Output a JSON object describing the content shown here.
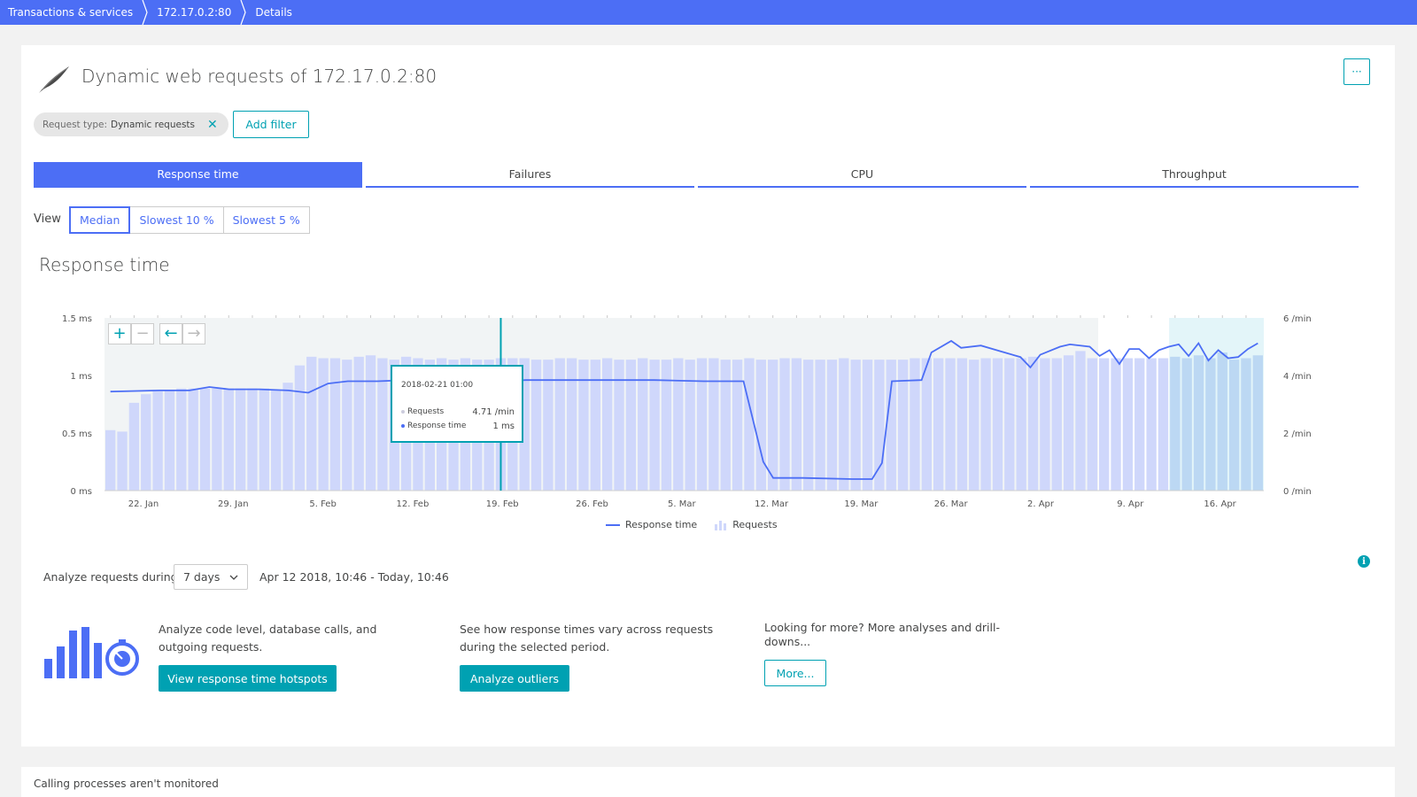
{
  "breadcrumb": [
    "Transactions & services",
    "172.17.0.2:80",
    "Details"
  ],
  "header": {
    "title": "Dynamic web requests of 172.17.0.2:80",
    "more_label": "···"
  },
  "filter": {
    "key": "Request type:",
    "value": "Dynamic requests",
    "remove": "✕",
    "add_label": "Add filter"
  },
  "tabs": [
    "Response time",
    "Failures",
    "CPU",
    "Throughput"
  ],
  "active_tab": "Response time",
  "view": {
    "label": "View",
    "options": [
      "Median",
      "Slowest 10 %",
      "Slowest 5 %"
    ],
    "selected": "Median"
  },
  "chart_title": "Response time",
  "zoom": {
    "zoom_in": "+",
    "zoom_out": "−",
    "back": "←",
    "forward": "→"
  },
  "tooltip": {
    "date": "2018-02-21 01:00",
    "requests_label": "Requests",
    "requests_value": "4.71 /min",
    "response_label": "Response time",
    "response_value": "1 ms"
  },
  "legend": {
    "response": "Response time",
    "requests": "Requests"
  },
  "colors": {
    "brand": "#4c6ef5",
    "accent": "#00a1b2",
    "bar": "#cfd7fb",
    "bar_highlight": "#bcd8f3"
  },
  "analyze": {
    "label": "Analyze requests during",
    "timeframe": "7 days",
    "range": "Apr 12 2018, 10:46 - Today, 10:46"
  },
  "actions": [
    {
      "text": "Analyze code level, database calls, and outgoing requests.",
      "button": "View response time hotspots"
    },
    {
      "text": "See how response times vary across requests during the selected period.",
      "button": "Analyze outliers"
    },
    {
      "text": "Looking for more? More analyses and drill-downs...",
      "button": "More..."
    }
  ],
  "footer_card": {
    "text": "Calling processes aren't monitored"
  },
  "chart_data": {
    "type": "bar+line",
    "x_ticks": [
      "22. Jan",
      "29. Jan",
      "5. Feb",
      "12. Feb",
      "19. Feb",
      "26. Feb",
      "5. Mar",
      "12. Mar",
      "19. Mar",
      "26. Mar",
      "2. Apr",
      "9. Apr",
      "16. Apr"
    ],
    "y_left": {
      "ticks": [
        "1.5 ms",
        "1 ms",
        "0.5 ms",
        "0 ms"
      ],
      "range": [
        0,
        1.5
      ],
      "unit": "ms"
    },
    "y_right": {
      "ticks": [
        "6 /min",
        "4 /min",
        "2 /min",
        "0 /min"
      ],
      "range": [
        0,
        6
      ],
      "unit": "/min"
    },
    "x_range_days": [
      0,
      93
    ],
    "series": [
      {
        "name": "Requests",
        "type": "bar",
        "values": [
          2.1,
          2.05,
          3.05,
          3.35,
          3.45,
          3.5,
          3.55,
          3.55,
          3.55,
          3.55,
          3.55,
          3.55,
          3.55,
          3.55,
          3.5,
          3.75,
          4.35,
          4.65,
          4.6,
          4.6,
          4.55,
          4.65,
          4.7,
          4.6,
          4.55,
          4.65,
          4.6,
          4.55,
          4.6,
          4.55,
          4.6,
          4.55,
          4.55,
          4.6,
          4.6,
          4.6,
          4.55,
          4.55,
          4.6,
          4.6,
          4.55,
          4.55,
          4.6,
          4.55,
          4.55,
          4.6,
          4.55,
          4.55,
          4.6,
          4.55,
          4.6,
          4.6,
          4.55,
          4.55,
          4.6,
          4.55,
          4.55,
          4.6,
          4.6,
          4.55,
          4.55,
          4.55,
          4.6,
          4.55,
          4.55,
          4.55,
          4.55,
          4.55,
          4.6,
          4.6,
          4.6,
          4.6,
          4.6,
          4.55,
          4.6,
          4.6,
          4.6,
          4.6,
          4.65,
          4.6,
          4.6,
          4.7,
          4.85,
          4.6,
          4.6,
          4.6,
          4.6,
          4.6,
          4.6,
          4.6,
          4.65,
          4.6,
          4.7,
          4.6,
          4.8,
          4.55,
          4.6,
          4.7
        ]
      },
      {
        "name": "Response time",
        "type": "line",
        "points": [
          [
            0,
            0.86
          ],
          [
            5,
            0.87
          ],
          [
            8,
            0.87
          ],
          [
            10,
            0.9
          ],
          [
            12,
            0.88
          ],
          [
            15,
            0.88
          ],
          [
            18,
            0.87
          ],
          [
            20,
            0.85
          ],
          [
            22,
            0.93
          ],
          [
            24,
            0.95
          ],
          [
            27,
            0.95
          ],
          [
            30,
            0.96
          ],
          [
            33,
            0.95
          ],
          [
            36,
            0.95
          ],
          [
            39,
            0.95
          ],
          [
            42,
            0.96
          ],
          [
            45,
            0.96
          ],
          [
            50,
            0.96
          ],
          [
            55,
            0.96
          ],
          [
            60,
            0.95
          ],
          [
            62,
            0.95
          ],
          [
            64,
            0.95
          ],
          [
            66,
            0.25
          ],
          [
            67,
            0.11
          ],
          [
            70,
            0.11
          ],
          [
            75,
            0.1
          ],
          [
            77,
            0.1
          ],
          [
            78,
            0.24
          ],
          [
            79,
            0.95
          ],
          [
            82,
            0.96
          ],
          [
            83,
            1.2
          ],
          [
            85,
            1.3
          ],
          [
            86,
            1.24
          ],
          [
            88,
            1.26
          ],
          [
            90,
            1.21
          ],
          [
            92,
            1.16
          ],
          [
            93,
            1.07
          ],
          [
            94,
            1.18
          ],
          [
            96,
            1.25
          ],
          [
            97,
            1.27
          ],
          [
            99,
            1.25
          ],
          [
            100,
            1.17
          ],
          [
            101,
            1.22
          ],
          [
            102,
            1.1
          ],
          [
            103,
            1.23
          ],
          [
            104,
            1.23
          ],
          [
            105,
            1.15
          ],
          [
            106,
            1.22
          ],
          [
            107,
            1.25
          ],
          [
            108,
            1.27
          ],
          [
            109,
            1.17
          ],
          [
            110,
            1.28
          ],
          [
            111,
            1.13
          ],
          [
            112,
            1.22
          ],
          [
            113,
            1.15
          ],
          [
            114,
            1.16
          ],
          [
            115,
            1.23
          ],
          [
            116,
            1.28
          ]
        ]
      }
    ],
    "highlight": {
      "from_index": 84,
      "to_index": 92
    },
    "cursor_index": 33
  }
}
